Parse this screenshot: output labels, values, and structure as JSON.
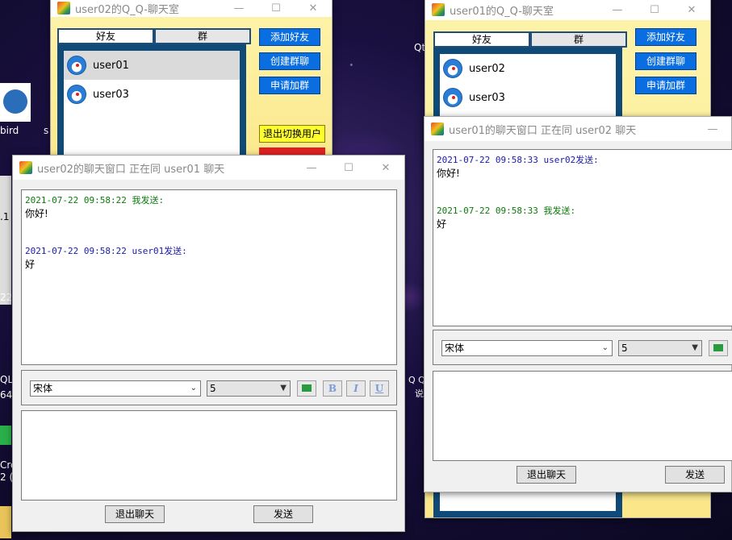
{
  "desktop": {
    "labels": [
      "bird",
      "s",
      ".1",
      "22",
      "QLy",
      "64",
      "Cre",
      "2 (",
      "Qt"
    ],
    "nebula_labels": [
      "Q Q",
      "说"
    ]
  },
  "qq_left": {
    "title": "user02的Q_Q-聊天室",
    "tabs": [
      "好友",
      "群"
    ],
    "friends": [
      "user01",
      "user03"
    ],
    "buttons": [
      "添加好友",
      "创建群聊",
      "申请加群"
    ],
    "switch_user": "退出切换用户",
    "controls": {
      "min": "—",
      "max": "☐",
      "close": "✕"
    }
  },
  "qq_right": {
    "title": "user01的Q_Q-聊天室",
    "tabs": [
      "好友",
      "群"
    ],
    "friends": [
      "user02",
      "user03"
    ],
    "buttons": [
      "添加好友",
      "创建群聊",
      "申请加群"
    ],
    "controls": {
      "min": "—",
      "max": "☐",
      "close": "✕"
    }
  },
  "chat_left": {
    "title": "user02的聊天窗口 正在同 user01 聊天",
    "messages": [
      {
        "header": "2021-07-22 09:58:22 我发送:",
        "text": "你好!",
        "mine": true
      },
      {
        "header": "2021-07-22 09:58:22 user01发送:",
        "text": "好",
        "mine": false
      }
    ],
    "font": "宋体",
    "size": "5",
    "format_buttons": [
      "B",
      "I",
      "U"
    ],
    "exit": "退出聊天",
    "send": "发送",
    "controls": {
      "min": "—",
      "max": "☐",
      "close": "✕"
    }
  },
  "chat_right": {
    "title": "user01的聊天窗口 正在同 user02 聊天",
    "messages": [
      {
        "header": "2021-07-22 09:58:33 user02发送:",
        "text": "你好!",
        "mine": false
      },
      {
        "header": "2021-07-22 09:58:33 我发送:",
        "text": "好",
        "mine": true
      }
    ],
    "font": "宋体",
    "size": "5",
    "exit": "退出聊天",
    "send": "发送",
    "controls": {
      "min": "—"
    }
  }
}
